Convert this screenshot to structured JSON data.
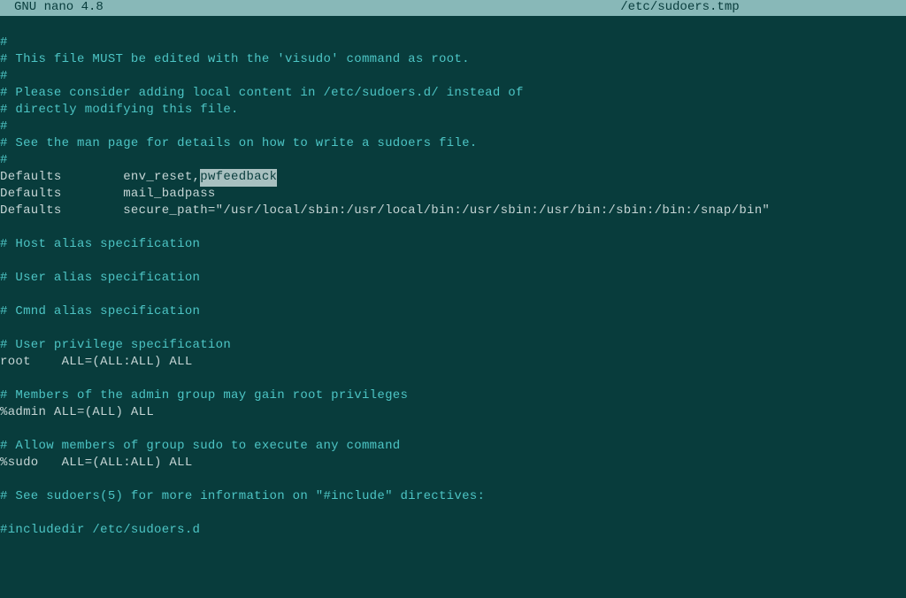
{
  "titlebar": {
    "app_name": "GNU nano 4.8",
    "filename": "/etc/sudoers.tmp"
  },
  "lines": [
    {
      "type": "comment",
      "text": "#"
    },
    {
      "type": "comment",
      "text": "# This file MUST be edited with the 'visudo' command as root."
    },
    {
      "type": "comment",
      "text": "#"
    },
    {
      "type": "comment",
      "text": "# Please consider adding local content in /etc/sudoers.d/ instead of"
    },
    {
      "type": "comment",
      "text": "# directly modifying this file."
    },
    {
      "type": "comment",
      "text": "#"
    },
    {
      "type": "comment",
      "text": "# See the man page for details on how to write a sudoers file."
    },
    {
      "type": "comment",
      "text": "#"
    },
    {
      "type": "defaults-highlight",
      "prefix": "Defaults        env_reset,",
      "highlight": "pwfeedback"
    },
    {
      "type": "normal",
      "text": "Defaults        mail_badpass"
    },
    {
      "type": "normal",
      "text": "Defaults        secure_path=\"/usr/local/sbin:/usr/local/bin:/usr/sbin:/usr/bin:/sbin:/bin:/snap/bin\""
    },
    {
      "type": "blank",
      "text": ""
    },
    {
      "type": "comment",
      "text": "# Host alias specification"
    },
    {
      "type": "blank",
      "text": ""
    },
    {
      "type": "comment",
      "text": "# User alias specification"
    },
    {
      "type": "blank",
      "text": ""
    },
    {
      "type": "comment",
      "text": "# Cmnd alias specification"
    },
    {
      "type": "blank",
      "text": ""
    },
    {
      "type": "comment",
      "text": "# User privilege specification"
    },
    {
      "type": "normal",
      "text": "root    ALL=(ALL:ALL) ALL"
    },
    {
      "type": "blank",
      "text": ""
    },
    {
      "type": "comment",
      "text": "# Members of the admin group may gain root privileges"
    },
    {
      "type": "normal",
      "text": "%admin ALL=(ALL) ALL"
    },
    {
      "type": "blank",
      "text": ""
    },
    {
      "type": "comment",
      "text": "# Allow members of group sudo to execute any command"
    },
    {
      "type": "normal",
      "text": "%sudo   ALL=(ALL:ALL) ALL"
    },
    {
      "type": "blank",
      "text": ""
    },
    {
      "type": "comment",
      "text": "# See sudoers(5) for more information on \"#include\" directives:"
    },
    {
      "type": "blank",
      "text": ""
    },
    {
      "type": "comment",
      "text": "#includedir /etc/sudoers.d"
    }
  ]
}
